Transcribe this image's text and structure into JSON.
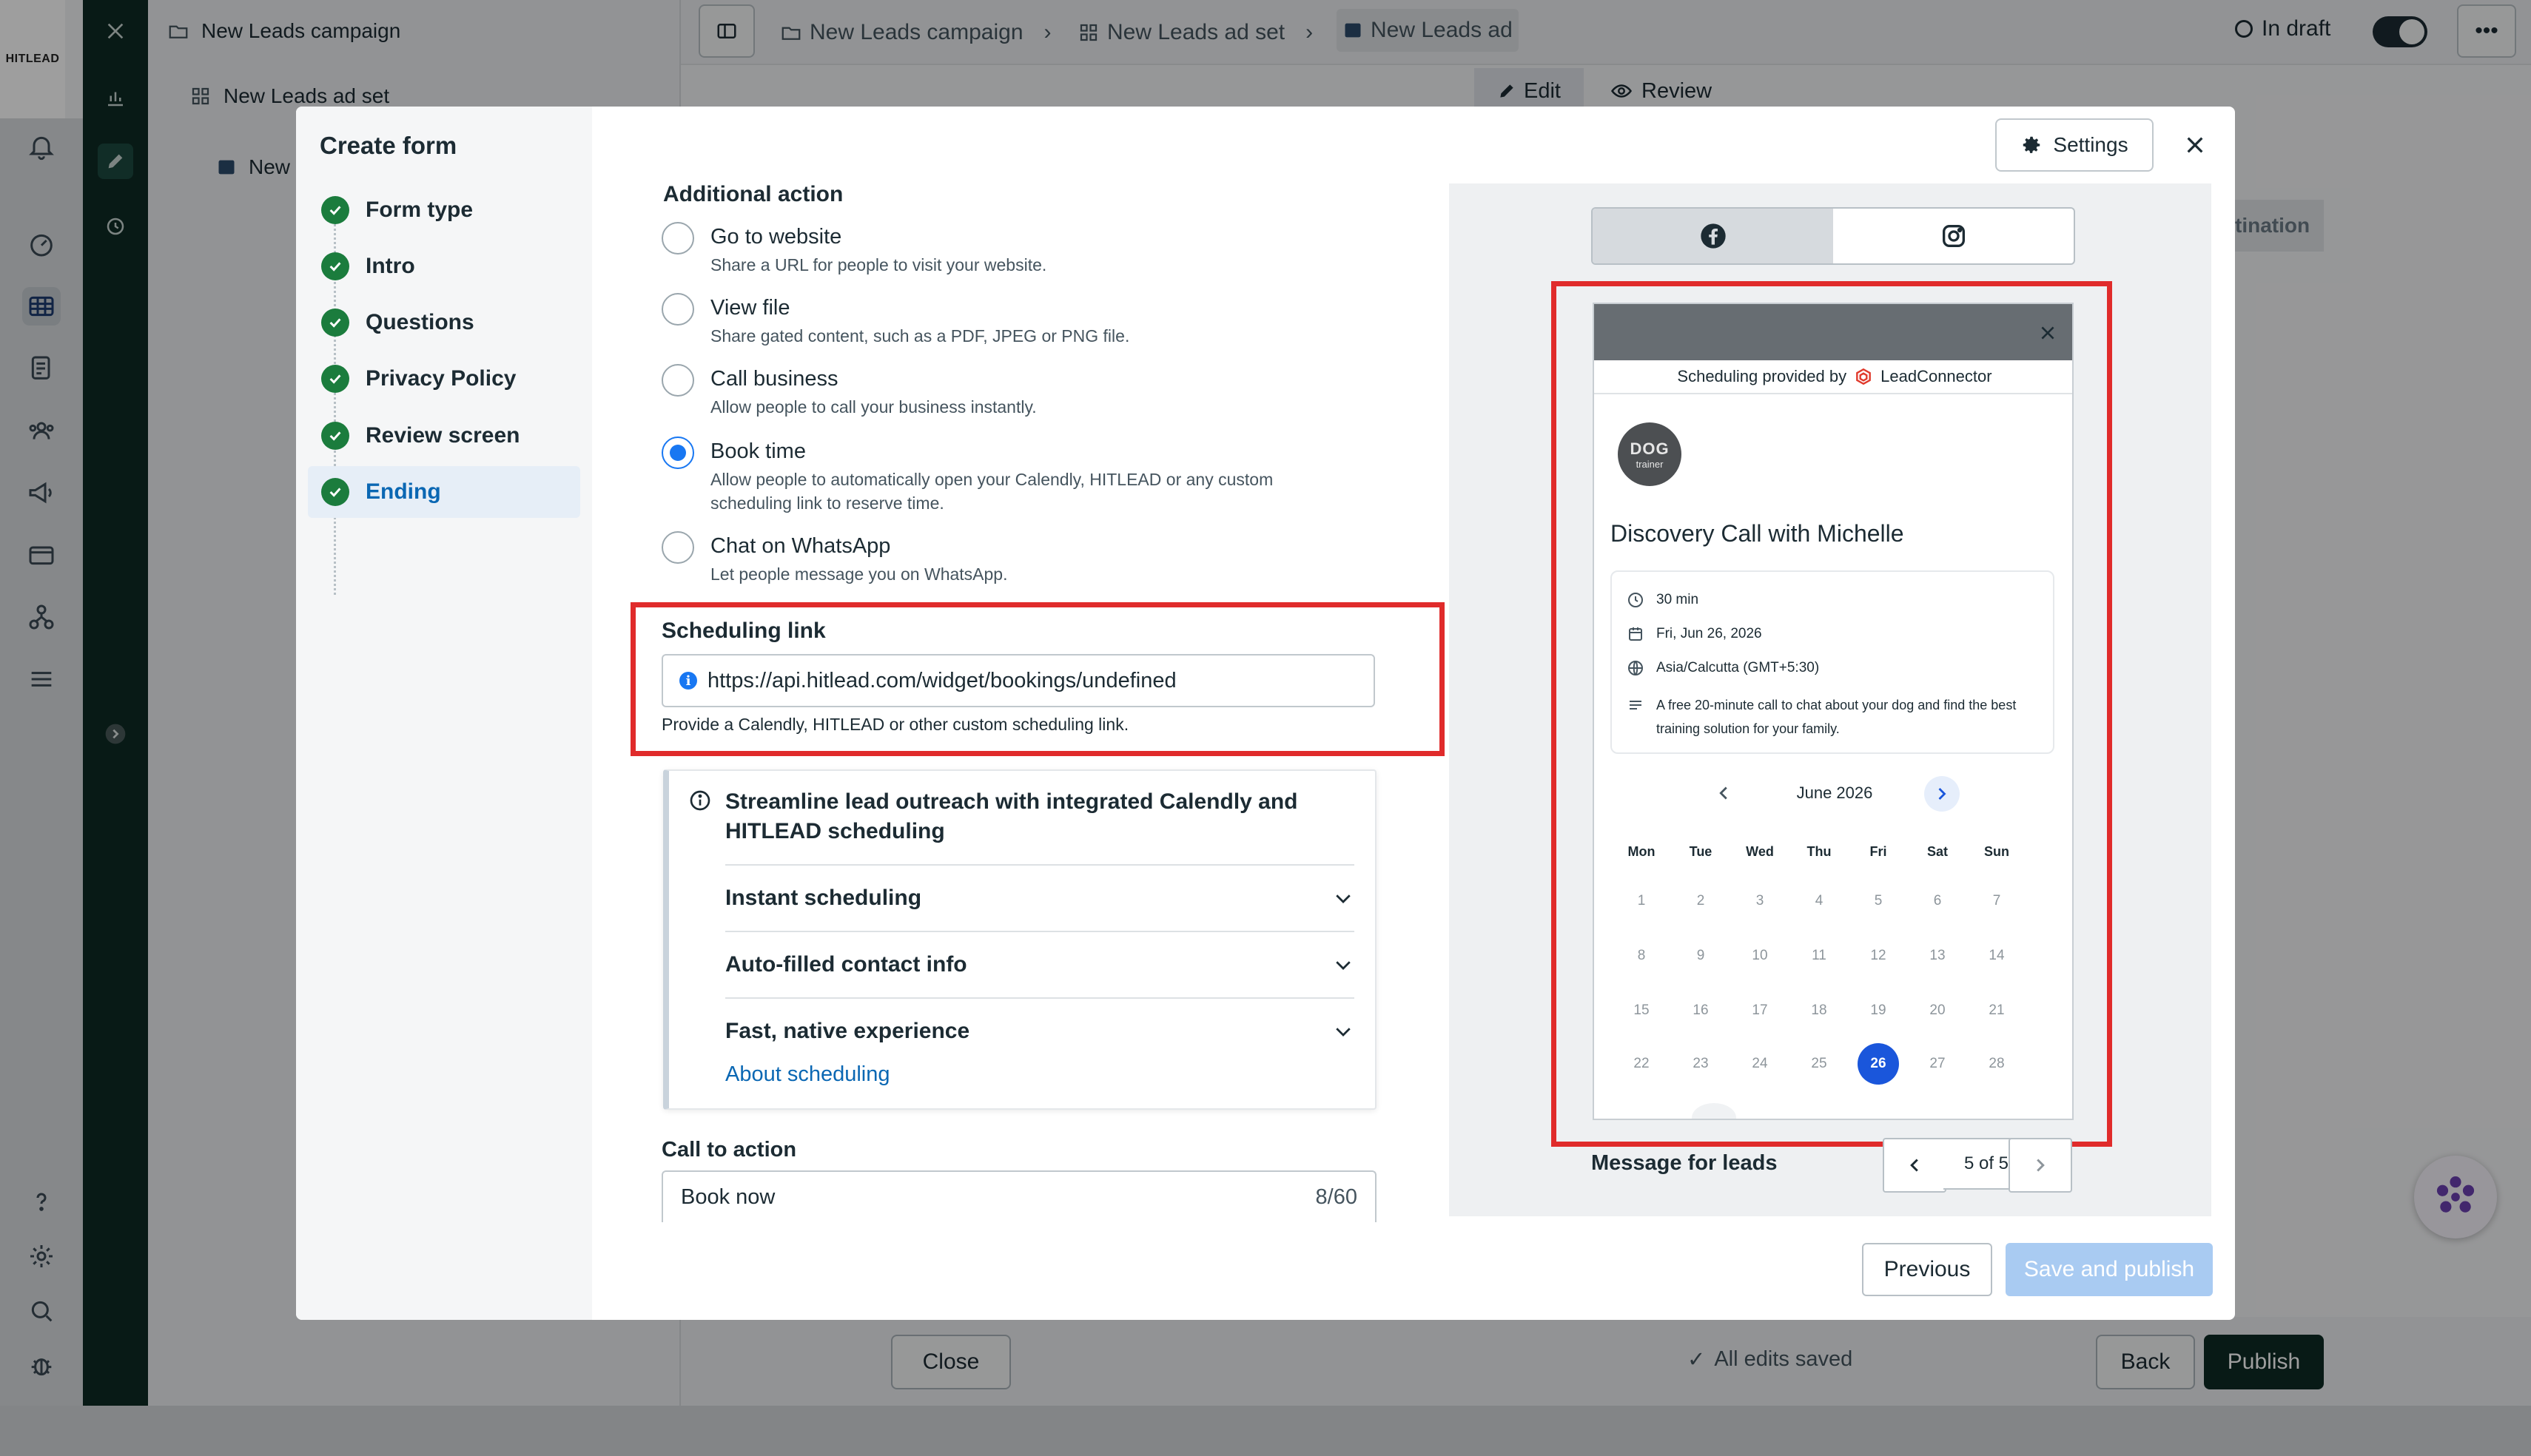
{
  "app": {
    "logo_text": "HITLEAD"
  },
  "tree": {
    "campaign": "New Leads campaign",
    "ad_set": "New Leads ad set",
    "ad": "New"
  },
  "breadcrumb": {
    "campaign": "New Leads campaign",
    "ad_set": "New Leads ad set",
    "ad": "New Leads ad"
  },
  "status": {
    "label": "In draft"
  },
  "edit_tabs": {
    "edit": "Edit",
    "review": "Review"
  },
  "bg_right": {
    "destination": "tination"
  },
  "bottom_bar": {
    "close": "Close",
    "saved": "All edits saved",
    "back": "Back",
    "publish": "Publish"
  },
  "modal": {
    "title": "Create form",
    "settings": "Settings",
    "steps": [
      {
        "label": "Form type"
      },
      {
        "label": "Intro"
      },
      {
        "label": "Questions"
      },
      {
        "label": "Privacy Policy"
      },
      {
        "label": "Review screen"
      },
      {
        "label": "Ending"
      }
    ],
    "additional_action": {
      "title": "Additional action",
      "options": [
        {
          "title": "Go to website",
          "desc": "Share a URL for people to visit your website."
        },
        {
          "title": "View file",
          "desc": "Share gated content, such as a PDF, JPEG or PNG file."
        },
        {
          "title": "Call business",
          "desc": "Allow people to call your business instantly."
        },
        {
          "title": "Book time",
          "desc": "Allow people to automatically open your Calendly, HITLEAD or any custom scheduling link to reserve time."
        },
        {
          "title": "Chat on WhatsApp",
          "desc": "Let people message you on WhatsApp."
        }
      ],
      "selected": "Book time"
    },
    "scheduling_link": {
      "label": "Scheduling link",
      "value": "https://api.hitlead.com/widget/bookings/undefined",
      "help": "Provide a Calendly, HITLEAD or other custom scheduling link."
    },
    "info_card": {
      "title": "Streamline lead outreach with integrated Calendly and HITLEAD scheduling",
      "items": [
        {
          "label": "Instant scheduling"
        },
        {
          "label": "Auto-filled contact info"
        },
        {
          "label": "Fast, native experience"
        }
      ],
      "link": "About scheduling"
    },
    "cta": {
      "label": "Call to action",
      "value": "Book now",
      "count": "8/60"
    },
    "preview": {
      "provided_by": "Scheduling provided by",
      "provider": "LeadConnector",
      "avatar_text": "DOG",
      "avatar_sub": "trainer",
      "event_title": "Discovery Call with Michelle",
      "duration": "30 min",
      "date": "Fri, Jun 26, 2026",
      "timezone": "Asia/Calcutta (GMT+5:30)",
      "description": "A free 20-minute call to chat about your dog and find the best training solution for your family.",
      "month": "June 2026",
      "weekdays": [
        "Mon",
        "Tue",
        "Wed",
        "Thu",
        "Fri",
        "Sat",
        "Sun"
      ],
      "weeks": [
        [
          "1",
          "2",
          "3",
          "4",
          "5",
          "6",
          "7"
        ],
        [
          "8",
          "9",
          "10",
          "11",
          "12",
          "13",
          "14"
        ],
        [
          "15",
          "16",
          "17",
          "18",
          "19",
          "20",
          "21"
        ],
        [
          "22",
          "23",
          "24",
          "25",
          "26",
          "27",
          "28"
        ]
      ],
      "selected_day": "26",
      "message_label": "Message for leads",
      "pager": "5 of 5"
    },
    "footer": {
      "previous": "Previous",
      "save_publish": "Save and publish"
    }
  },
  "colors": {
    "accent": "#1877f2",
    "highlight": "#e02b2b",
    "success": "#1b7c3d",
    "dark_rail": "#0d2a24"
  }
}
